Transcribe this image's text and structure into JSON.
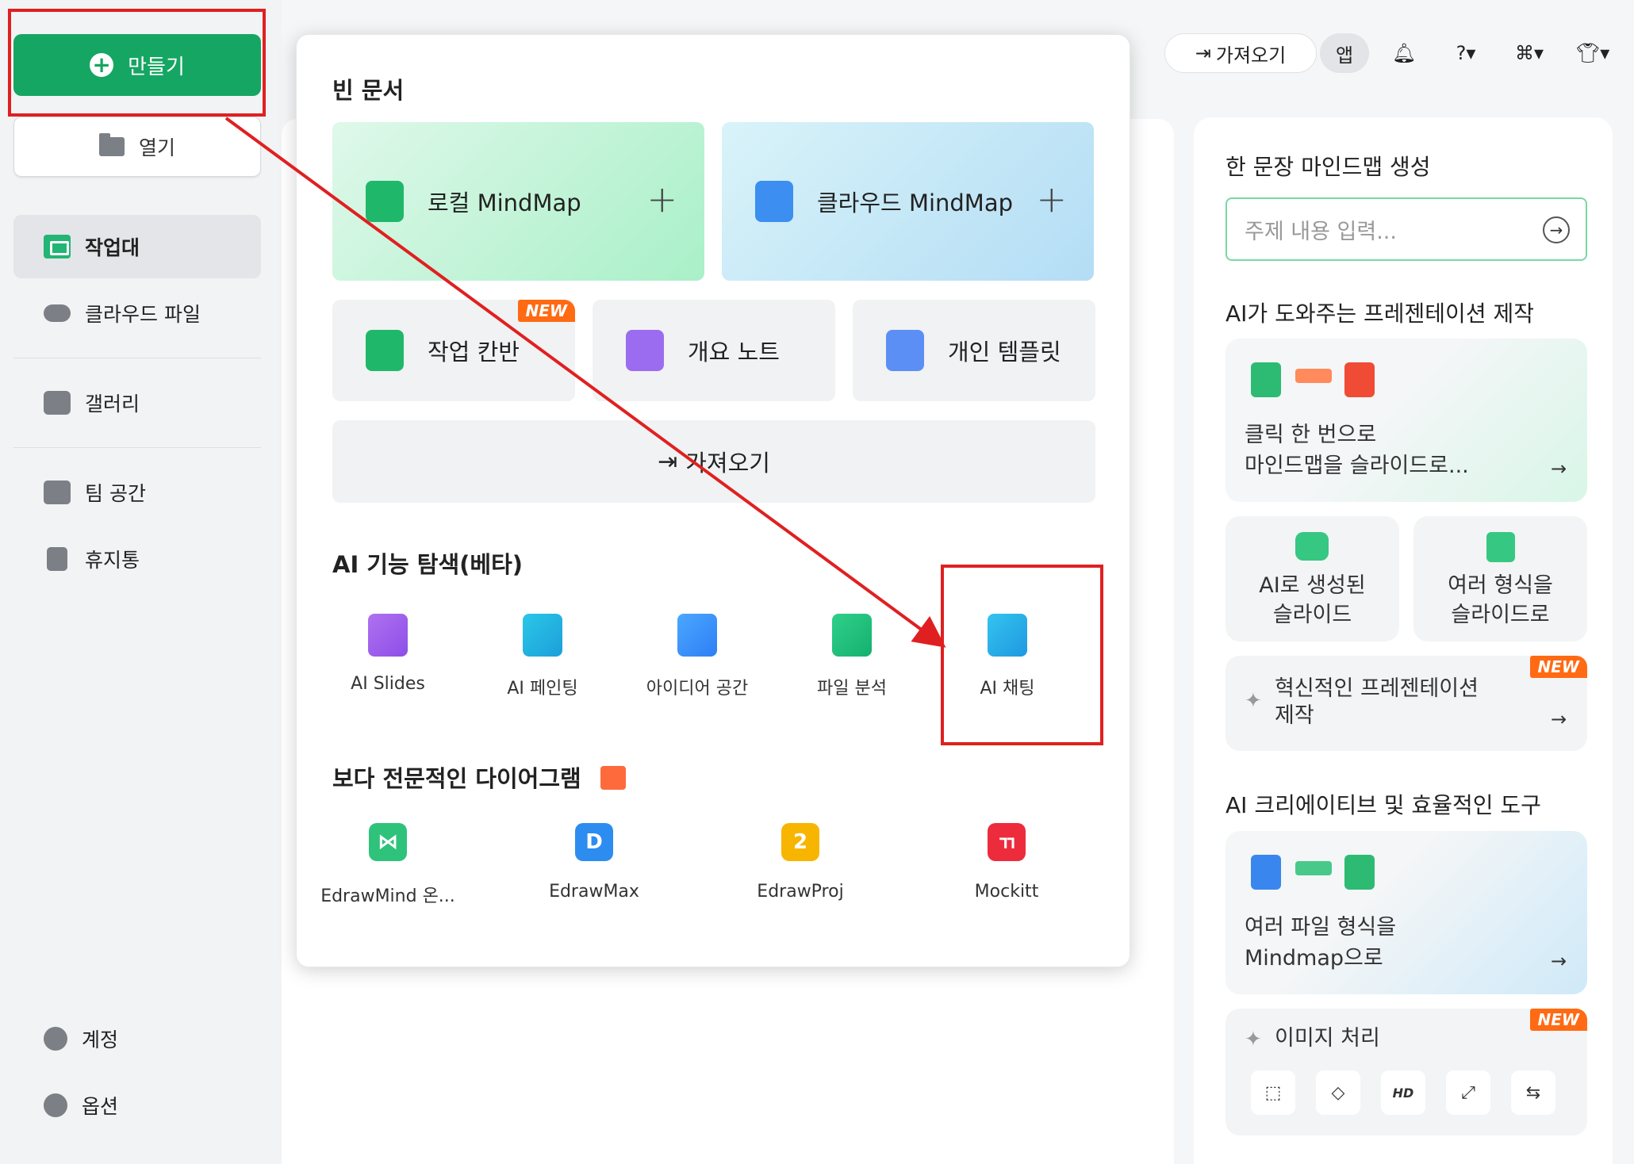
{
  "sidebar": {
    "create_label": "만들기",
    "open_label": "열기",
    "items": [
      {
        "label": "작업대"
      },
      {
        "label": "클라우드 파일"
      },
      {
        "label": "갤러리"
      },
      {
        "label": "팀 공간"
      },
      {
        "label": "휴지통"
      }
    ],
    "bottom": [
      {
        "label": "계정"
      },
      {
        "label": "옵션"
      }
    ]
  },
  "header": {
    "import_label": "가져오기",
    "app_label": "앱"
  },
  "popup": {
    "blank_title": "빈 문서",
    "local_mindmap": "로컬 MindMap",
    "cloud_mindmap": "클라우드 MindMap",
    "kanban": "작업 칸반",
    "outline": "개요 노트",
    "template": "개인 템플릿",
    "new_badge": "NEW",
    "import_label": "가져오기",
    "ai_title": "AI 기능 탐색(베타)",
    "ai_items": [
      {
        "label": "AI Slides"
      },
      {
        "label": "AI 페인팅"
      },
      {
        "label": "아이디어 공간"
      },
      {
        "label": "파일 분석"
      },
      {
        "label": "AI 채팅"
      }
    ],
    "pro_title": "보다 전문적인 다이어그램",
    "pro_items": [
      {
        "label": "EdrawMind 온..."
      },
      {
        "label": "EdrawMax"
      },
      {
        "label": "EdrawProj"
      },
      {
        "label": "Mockitt"
      }
    ]
  },
  "right_panel": {
    "one_sentence_title": "한 문장 마인드맵 생성",
    "topic_placeholder": "주제 내용 입력...",
    "ai_pres_title": "AI가 도와주는 프레젠테이션 제작",
    "one_click_line1": "클릭 한 번으로",
    "one_click_line2": "마인드맵을 슬라이드로...",
    "ai_slides_line1": "AI로 생성된",
    "ai_slides_line2": "슬라이드",
    "multi_format_line1": "여러 형식을",
    "multi_format_line2": "슬라이드로",
    "innovative_line1": "혁신적인 프레젠테이션",
    "innovative_line2": "제작",
    "new_badge": "NEW",
    "creative_title": "AI 크리에이티브 및 효율적인 도구",
    "file_to_mm_line1": "여러 파일 형식을",
    "file_to_mm_line2": "Mindmap으로",
    "image_proc": "이미지 처리",
    "hd_label": "HD"
  },
  "colors": {
    "accent_green": "#16a663",
    "annotation_red": "#e02020",
    "new_orange": "#ff6a13"
  }
}
